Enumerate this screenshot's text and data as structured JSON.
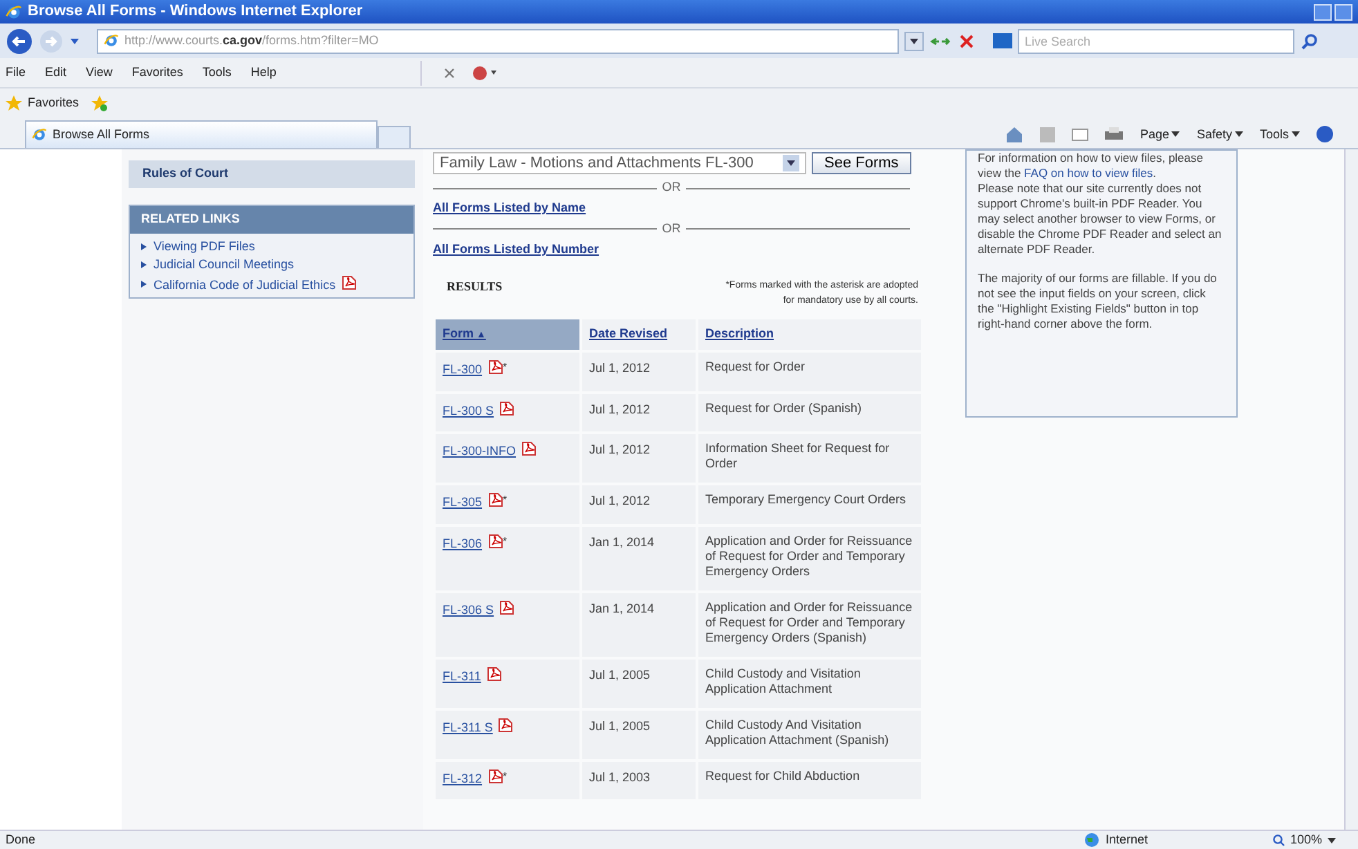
{
  "window": {
    "title": "Browse All Forms - Windows Internet Explorer"
  },
  "address": {
    "prefix": "http://www.courts.",
    "domain": "ca.gov",
    "suffix": "/forms.htm?filter=MO"
  },
  "search": {
    "placeholder": "Live Search"
  },
  "menu": [
    "File",
    "Edit",
    "View",
    "Favorites",
    "Tools",
    "Help"
  ],
  "favorites_label": "Favorites",
  "tab": {
    "title": "Browse All Forms"
  },
  "command_bar": [
    "Page",
    "Safety",
    "Tools"
  ],
  "sidebar": {
    "rules": "Rules of Court",
    "related_title": "RELATED LINKS",
    "links": [
      {
        "text": "Viewing PDF Files",
        "pdf": false
      },
      {
        "text": "Judicial Council Meetings",
        "pdf": false
      },
      {
        "text": "California Code of Judicial Ethics",
        "pdf": true
      }
    ]
  },
  "filter": {
    "value": "Family Law - Motions and Attachments FL-300",
    "button": "See Forms"
  },
  "or_labels": [
    "OR",
    "OR"
  ],
  "list_links": [
    "All Forms Listed by Name",
    "All Forms Listed by Number"
  ],
  "results": {
    "title": "RESULTS",
    "note": "*Forms marked with the asterisk are adopted for mandatory use by all courts."
  },
  "table": {
    "columns": [
      {
        "label": "Form",
        "sort": "▲",
        "selected": true
      },
      {
        "label": "Date Revised",
        "selected": false
      },
      {
        "label": "Description",
        "selected": false
      }
    ],
    "rows": [
      {
        "form": "FL-300",
        "asterisk": "*",
        "date": "Jul 1, 2012",
        "description": "Request for Order"
      },
      {
        "form": "FL-300 S",
        "date": "Jul 1, 2012",
        "description": "Request for Order (Spanish)"
      },
      {
        "form": "FL-300-INFO",
        "date": "Jul 1, 2012",
        "description": "Information Sheet for Request for Order"
      },
      {
        "form": "FL-305",
        "asterisk": "*",
        "date": "Jul 1, 2012",
        "description": "Temporary Emergency Court Orders"
      },
      {
        "form": "FL-306",
        "asterisk": "*",
        "date": "Jan 1, 2014",
        "description": "Application and Order for Reissuance of Request for Order and Temporary Emergency Orders"
      },
      {
        "form": "FL-306 S",
        "date": "Jan 1, 2014",
        "description": "Application and Order for Reissuance of Request for Order and Temporary Emergency Orders (Spanish)"
      },
      {
        "form": "FL-311",
        "date": "Jul 1, 2005",
        "description": "Child Custody and Visitation Application Attachment"
      },
      {
        "form": "FL-311 S",
        "date": "Jul 1, 2005",
        "description": "Child Custody And Visitation Application Attachment (Spanish)"
      },
      {
        "form": "FL-312",
        "asterisk": "*",
        "date": "Jul 1, 2003",
        "description": "Request for Child Abduction"
      }
    ]
  },
  "info": {
    "paragraphs": [
      {
        "before": "For information on how to view files, please view the ",
        "link": "FAQ on how to view files",
        "after": "."
      },
      {
        "before": "Please note that our site currently does not support Chrome's built-in PDF Reader. You may select another browser to view Forms, or disable the Chrome PDF Reader and select an alternate PDF Reader."
      },
      {
        "before": "The majority of our forms are fillable. If you do not see the input fields on your screen, click the \"Highlight Existing Fields\" button in top right-hand corner above the form."
      }
    ]
  },
  "status_bar": {
    "text": "Done",
    "zone": "Internet",
    "zoom": "100%"
  }
}
